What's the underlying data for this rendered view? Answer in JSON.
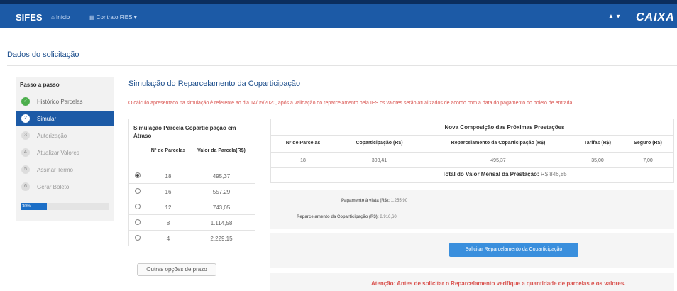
{
  "header": {
    "app_name": "SIFES",
    "nav_home": "⌂ Início",
    "nav_fies": "▤ Contrato FIES ▾",
    "user_icon": "▲ ▾",
    "brand": "CAIXA",
    "brand_color": "#1c5aa6"
  },
  "page": {
    "title": "Dados do solicitação"
  },
  "sidebar": {
    "title": "Passo a passo",
    "steps": [
      {
        "num": "✓",
        "label": "Histórico Parcelas"
      },
      {
        "num": "2",
        "label": "Simular"
      },
      {
        "num": "3",
        "label": "Autorização"
      },
      {
        "num": "4",
        "label": "Atualizar Valores"
      },
      {
        "num": "5",
        "label": "Assinar Termo"
      },
      {
        "num": "6",
        "label": "Gerar Boleto"
      }
    ],
    "progress_label": "30%",
    "progress_value": 0.3
  },
  "main": {
    "title": "Simulação do Reparcelamento da Coparticipação",
    "notice": "O cálculo apresentado na simulação é referente ao dia 14/05/2020, após a validação do reparcelamento pela IES os valores serão atualizados de acordo com a data do pagamento do boleto de entrada."
  },
  "left_table": {
    "title": "Simulação Parcela Coparticipação em Atraso",
    "col_parcelas": "Nº de Parcelas",
    "col_valor": "Valor da Parcela(R$)",
    "rows": [
      {
        "parcelas": "18",
        "valor": "495,37",
        "selected": true
      },
      {
        "parcelas": "16",
        "valor": "557,29",
        "selected": false
      },
      {
        "parcelas": "12",
        "valor": "743,05",
        "selected": false
      },
      {
        "parcelas": "8",
        "valor": "1.114,58",
        "selected": false
      },
      {
        "parcelas": "4",
        "valor": "2.229,15",
        "selected": false
      }
    ]
  },
  "buttons": {
    "outras": "Outras opções de prazo",
    "solicitar": "Solicitar Reparcelamento da Coparticipação"
  },
  "right_table": {
    "title": "Nova Composição das Próximas Prestações",
    "headers": [
      "Nº de Parcelas",
      "Coparticipação (R$)",
      "Reparcelamento da Coparticipação (R$)",
      "Tarifas (R$)",
      "Seguro (R$)"
    ],
    "values": [
      "18",
      "308,41",
      "495,37",
      "35,00",
      "7,00"
    ],
    "total_label": "Total do Valor Mensal da Prestação:",
    "total_value": "R$ 846,85"
  },
  "summary": {
    "avista_label": "Pagamento à vista (R$):",
    "avista_value": "1.255,90",
    "reparc_label": "Reparcelamento da Coparticipação (R$):",
    "reparc_value": "8.916,60"
  },
  "alert": "Atenção: Antes de solicitar o Reparcelamento verifique a quantidade de parcelas e os valores."
}
